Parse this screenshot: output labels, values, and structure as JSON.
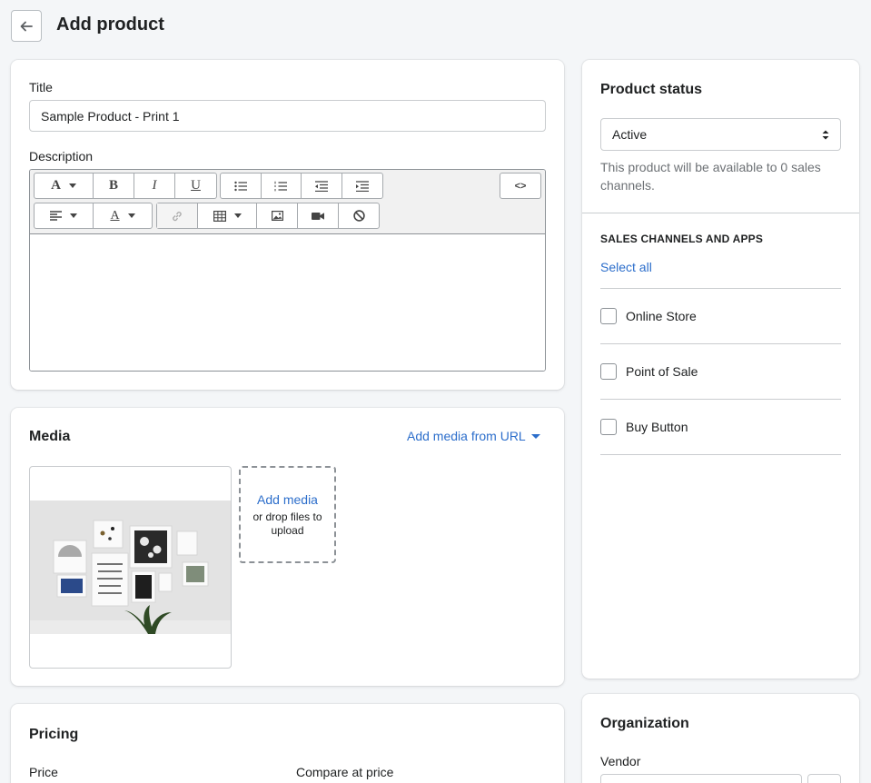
{
  "header": {
    "back_icon": "arrow-left-icon",
    "title": "Add product"
  },
  "product_form": {
    "title_label": "Title",
    "title_value": "Sample Product - Print 1",
    "description_label": "Description",
    "toolbar": {
      "row1": [
        "font-style-icon",
        "bold-icon",
        "italic-icon",
        "underline-icon",
        "bullet-list-icon",
        "numbered-list-icon",
        "outdent-icon",
        "indent-icon",
        "html-code-icon"
      ],
      "row2": [
        "align-icon",
        "text-color-icon",
        "link-icon",
        "table-icon",
        "image-icon",
        "video-icon",
        "clear-formatting-icon"
      ],
      "code_label": "<>",
      "bold_label": "B",
      "italic_label": "I",
      "underline_label": "U",
      "font_label": "A",
      "color_label": "A"
    },
    "description_value": ""
  },
  "media": {
    "title": "Media",
    "add_from_url": "Add media from URL",
    "add_media_label": "Add media",
    "drop_hint": "or drop files to upload",
    "image_alt": "Gallery wall of framed prints with a potted plant"
  },
  "pricing": {
    "title": "Pricing",
    "price_label": "Price",
    "compare_label": "Compare at price"
  },
  "status": {
    "title": "Product status",
    "selected": "Active",
    "help": "This product will be available to 0 sales channels.",
    "channels_heading": "SALES CHANNELS AND APPS",
    "select_all": "Select all",
    "channels": [
      {
        "label": "Online Store",
        "checked": false
      },
      {
        "label": "Point of Sale",
        "checked": false
      },
      {
        "label": "Buy Button",
        "checked": false
      }
    ]
  },
  "organization": {
    "title": "Organization",
    "vendor_label": "Vendor"
  },
  "colors": {
    "link": "#2c6ecb",
    "background": "#f4f6f8",
    "border": "#c9cccf"
  }
}
